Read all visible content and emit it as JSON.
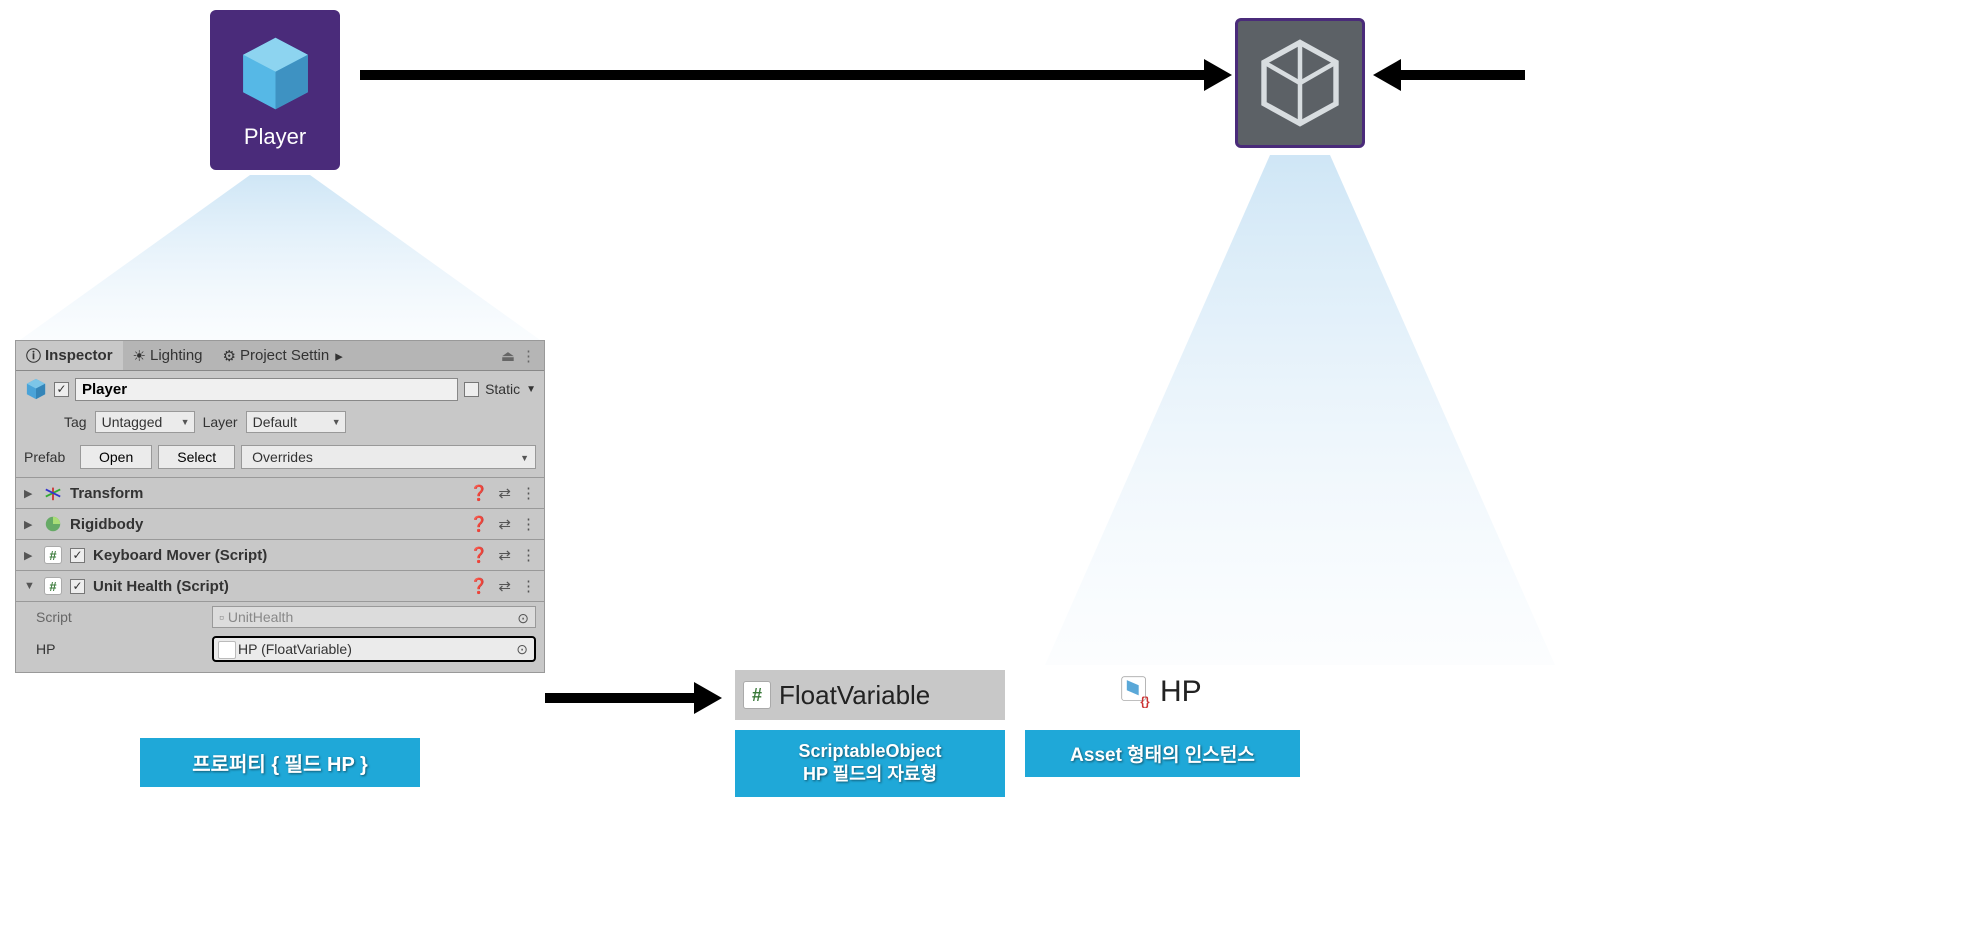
{
  "player": {
    "label": "Player"
  },
  "inspector": {
    "tabs": {
      "t0": "Inspector",
      "t1": "Lighting",
      "t2": "Project Settin"
    },
    "name": "Player",
    "static_label": "Static",
    "tag_label": "Tag",
    "tag_value": "Untagged",
    "layer_label": "Layer",
    "layer_value": "Default",
    "prefab_label": "Prefab",
    "open_btn": "Open",
    "select_btn": "Select",
    "overrides_btn": "Overrides",
    "components": {
      "transform": "Transform",
      "rigidbody": "Rigidbody",
      "keyboard_mover": "Keyboard Mover (Script)",
      "unit_health": "Unit Health (Script)"
    },
    "script_label": "Script",
    "script_value": "UnitHealth",
    "hp_label": "HP",
    "hp_value": "HP (FloatVariable)"
  },
  "fv": {
    "label": "FloatVariable"
  },
  "hp_asset": {
    "label": "HP"
  },
  "captions": {
    "c1": "프로퍼티 { 필드 HP }",
    "c2_line1": "ScriptableObject",
    "c2_line2": "HP 필드의 자료형",
    "c3": "Asset 형태의 인스턴스"
  }
}
